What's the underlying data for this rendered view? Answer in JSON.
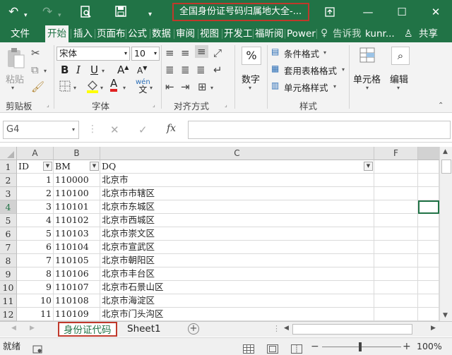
{
  "title_bar": {
    "title": "全国身份证号码归属地大全-..."
  },
  "menu_tabs": [
    {
      "label": "文件"
    },
    {
      "label": "开始"
    },
    {
      "label": "插入"
    },
    {
      "label": "页面布"
    },
    {
      "label": "公式"
    },
    {
      "label": "数据"
    },
    {
      "label": "审阅"
    },
    {
      "label": "视图"
    },
    {
      "label": "开发工"
    },
    {
      "label": "福昕阅"
    },
    {
      "label": "Power"
    }
  ],
  "tell_me": "告诉我",
  "user": "kunr...",
  "share": "共享",
  "ribbon": {
    "paste_label": "粘贴",
    "clipboard_group": "剪贴板",
    "font_name": "宋体",
    "font_size": "10",
    "font_group": "字体",
    "align_group": "对齐方式",
    "number_label": "数字",
    "number_symbol": "%",
    "cond_format": "条件格式",
    "table_format": "套用表格格式",
    "cell_style": "单元格样式",
    "styles_group": "样式",
    "cells_label": "单元格",
    "edit_label": "编辑"
  },
  "formula_bar": {
    "name_box": "G4",
    "fx": "fx",
    "content": ""
  },
  "columns": [
    "A",
    "B",
    "C",
    "F"
  ],
  "header_row": {
    "row": "1",
    "a": "ID",
    "b": "BM",
    "c": "DQ"
  },
  "rows": [
    {
      "row": "2",
      "a": "1",
      "b": "110000",
      "c": "北京市"
    },
    {
      "row": "3",
      "a": "2",
      "b": "110100",
      "c": "北京市市辖区"
    },
    {
      "row": "4",
      "a": "3",
      "b": "110101",
      "c": "北京市东城区"
    },
    {
      "row": "5",
      "a": "4",
      "b": "110102",
      "c": "北京市西城区"
    },
    {
      "row": "6",
      "a": "5",
      "b": "110103",
      "c": "北京市崇文区"
    },
    {
      "row": "7",
      "a": "6",
      "b": "110104",
      "c": "北京市宣武区"
    },
    {
      "row": "8",
      "a": "7",
      "b": "110105",
      "c": "北京市朝阳区"
    },
    {
      "row": "9",
      "a": "8",
      "b": "110106",
      "c": "北京市丰台区"
    },
    {
      "row": "10",
      "a": "9",
      "b": "110107",
      "c": "北京市石景山区"
    },
    {
      "row": "11",
      "a": "10",
      "b": "110108",
      "c": "北京市海淀区"
    },
    {
      "row": "12",
      "a": "11",
      "b": "110109",
      "c": "北京市门头沟区"
    }
  ],
  "sheets": [
    {
      "label": "身份证代码",
      "active": true
    },
    {
      "label": "Sheet1",
      "active": false
    }
  ],
  "status": {
    "ready": "就绪",
    "zoom": "100%"
  },
  "colors": {
    "accent": "#217346",
    "highlight_border": "#c0392b",
    "selection": "#217346"
  }
}
